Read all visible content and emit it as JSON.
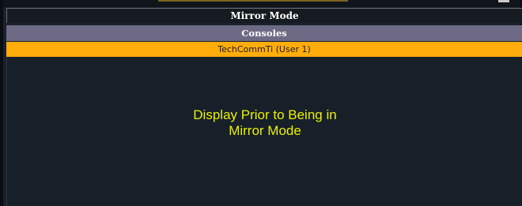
{
  "window": {
    "title": "Mirror Mode"
  },
  "consoles": {
    "header": "Consoles",
    "items": [
      {
        "label": "TechCommTi (User 1)",
        "selected": true
      }
    ]
  },
  "content": {
    "caption_line1": "Display Prior to Being in",
    "caption_line2": "Mirror Mode"
  },
  "colors": {
    "background": "#172029",
    "header_bar": "#6e6a86",
    "selected_row": "#ffad0d",
    "caption_text": "#eaf000"
  }
}
